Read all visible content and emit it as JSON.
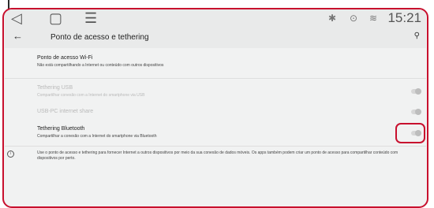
{
  "status_bar": {
    "back_icon": "back-triangle-icon",
    "home_icon": "home-square-icon",
    "menu_icon": "menu-lines-icon",
    "bluetooth_icon": "bluetooth-icon",
    "location_icon": "location-icon",
    "wifi_icon": "wifi-icon",
    "time": "15:21"
  },
  "app_bar": {
    "title": "Ponto de acesso e tethering",
    "back_icon": "arrow-back-icon",
    "search_icon": "search-icon"
  },
  "settings": [
    {
      "title": "Ponto de acesso Wi-Fi",
      "subtitle": "Não está compartilhando a Internet ou conteúdo com outros dispositivos",
      "enabled": true,
      "toggle": false
    },
    {
      "title": "Tethering USB",
      "subtitle": "Compartilhar conexão com a Internet do smartphone via USB",
      "enabled": false,
      "toggle": true,
      "toggle_on": false
    },
    {
      "title": "USB-PC internet share",
      "subtitle": "",
      "enabled": false,
      "toggle": true,
      "toggle_on": false
    },
    {
      "title": "Tethering Bluetooth",
      "subtitle": "Compartilhar a conexão com a Internet do smartphone via Bluetooth",
      "enabled": true,
      "toggle": true,
      "toggle_on": false
    }
  ],
  "info": {
    "text": "Use o ponto de acesso e tethering para fornecer Internet a outros dispositivos por meio da sua conexão de dados móveis. Os apps também podem criar um ponto de acesso para compartilhar conteúdo com dispositivos por perto."
  },
  "colors": {
    "highlight": "#c8102e",
    "background": "#f1f2f2",
    "bar": "#e9eaea"
  }
}
